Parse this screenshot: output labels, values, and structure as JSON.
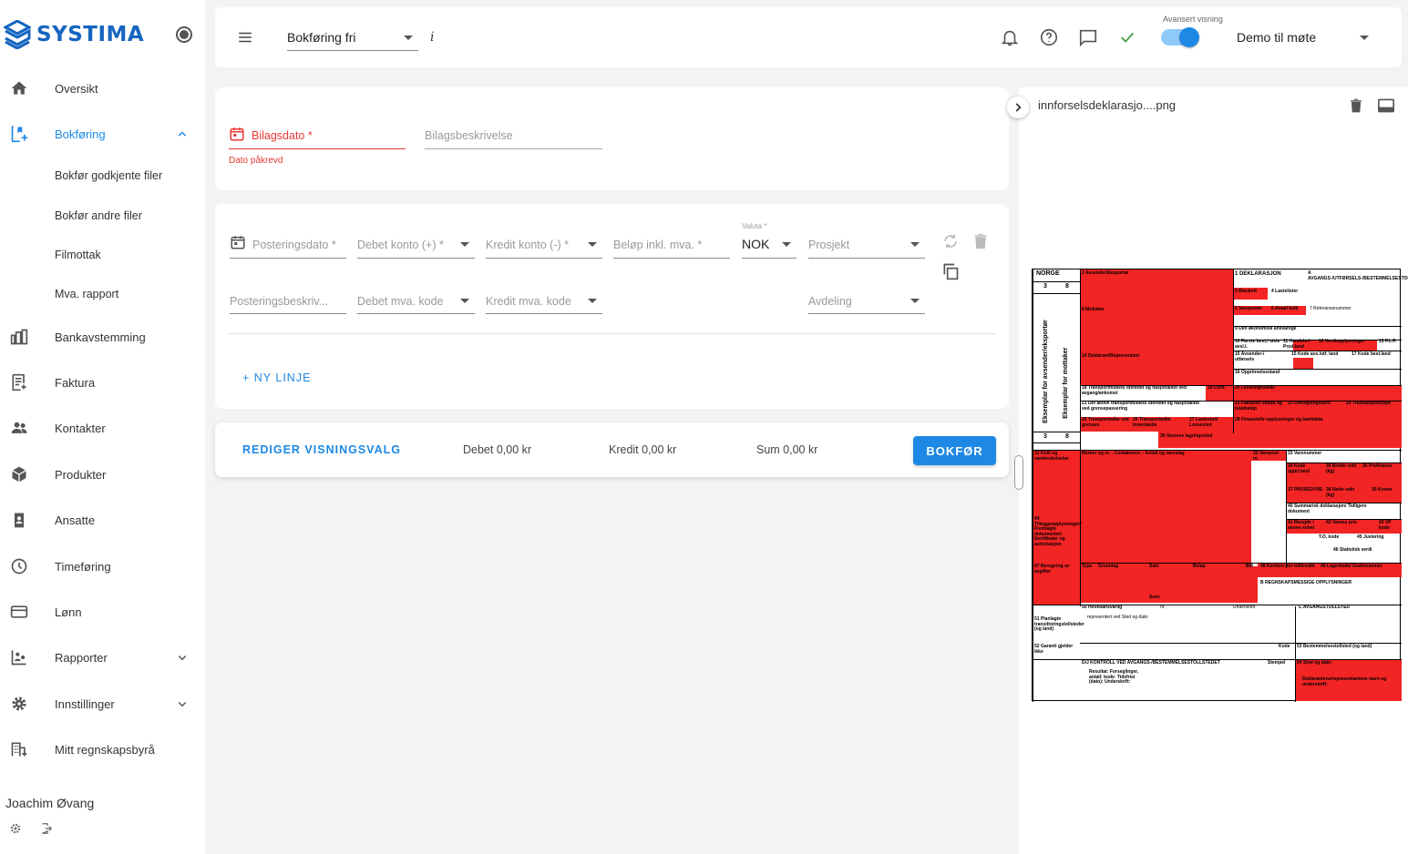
{
  "brand": {
    "name": "SYSTIMA"
  },
  "sidebar": {
    "items": [
      {
        "label": "Oversikt",
        "icon": "home-icon"
      },
      {
        "label": "Bokføring",
        "icon": "book-icon"
      },
      {
        "label": "Bankavstemming",
        "icon": "bank-icon"
      },
      {
        "label": "Faktura",
        "icon": "invoice-icon"
      },
      {
        "label": "Kontakter",
        "icon": "people-icon"
      },
      {
        "label": "Produkter",
        "icon": "box-icon"
      },
      {
        "label": "Ansatte",
        "icon": "badge-icon"
      },
      {
        "label": "Timeføring",
        "icon": "clock-icon"
      },
      {
        "label": "Lønn",
        "icon": "card-icon"
      },
      {
        "label": "Rapporter",
        "icon": "report-icon"
      },
      {
        "label": "Innstillinger",
        "icon": "gear-icon"
      },
      {
        "label": "Mitt regnskapsbyrå",
        "icon": "building-icon"
      }
    ],
    "subitems": [
      "Bokfør godkjente filer",
      "Bokfør andre filer",
      "Filmottak",
      "Mva. rapport"
    ],
    "user": "Joachim Øvang"
  },
  "topbar": {
    "company_select": "Bokføring fri",
    "info": "i",
    "advanced_label": "Avansert visning",
    "advanced_on": true,
    "workspace": "Demo til møte"
  },
  "voucher": {
    "date_label": "Bilagsdato *",
    "date_error": "Dato påkrevd",
    "description_label": "Bilagsbeskrivelse"
  },
  "posting": {
    "date_label": "Posteringsdato *",
    "debit_label": "Debet konto (+) *",
    "credit_label": "Kredit konto (-) *",
    "amount_label": "Beløp inkl. mva. *",
    "currency_label": "Valuta *",
    "currency_value": "NOK",
    "project_label": "Prosjekt",
    "desc_label": "Posteringsbeskriv...",
    "debit_vat_label": "Debet mva. kode",
    "credit_vat_label": "Kredit mva. kode",
    "department_label": "Avdeling",
    "new_line": "+ NY LINJE"
  },
  "footer": {
    "edit_view": "REDIGER VISNINGSVALG",
    "debit": "Debet 0,00 kr",
    "credit": "Kredit 0,00 kr",
    "sum": "Sum 0,00 kr",
    "submit": "BOKFØR"
  },
  "preview": {
    "filename": "innforselsdeklarasjo....png",
    "doc": {
      "country": "NORGE",
      "num_a": "3",
      "num_b": "8",
      "side_left": "Eksemplar for avsender/eksportør",
      "side_right": "Eksemplar for mottaker",
      "f2": "2 Avsender/Eksportør",
      "f1": "1 DEKLARASJON",
      "fa": "A AVGANGS-/UTFØRSELS-/BESTEMMELSESTOLLSTED",
      "f3": "3 Blankett",
      "f4": "4 Lastelister",
      "f5": "5 Vareposter",
      "f6": "6 Antall kolli",
      "f7": "7 Referansenummer",
      "f8": "8 Mottaker",
      "f9": "9 Den økonomisk ansvarlige",
      "f10": "10 Første best./ siste avsl.l.",
      "f11": "11 Handels-/ Prod.land",
      "f12": "12 Verdiopplysninger",
      "f13": "13 F.L.P.",
      "f14": "14 Deklarant/Representant",
      "f15": "15 Avsender-/ utførsels",
      "f15a": "15 Kode avs./utf. land",
      "f17": "17 Kode best.land",
      "f16": "16 Opprinnelsesland",
      "f18": "18 Transportmidlets identitet og nasjonalitet ved avgang/ankomst",
      "f19": "19 Cont.",
      "f20": "20 Leveringsvilkår",
      "f21": "21 Det aktive transportmidlets identitet og nasjonalitet ved grensepassering",
      "f22": "22 Fakturert valuta og totalbeløp",
      "f23": "23 Omregningskurs",
      "f24": "24 Transaksjonstype",
      "f25": "25 Transportmåte ved grensen",
      "f26": "26 Transportmåte innenlands",
      "f27": "27 Lastested/ Lossested",
      "f28": "28 Finansielle opplysninger og bankdata",
      "f30": "30 Varenes lagringssted",
      "f31": "31 Kolli og varebeskrivelse",
      "fmerker": "Merker og nr. - Containernr. - Antall og vareslag",
      "f32": "32 Varepost nr.",
      "f33": "33 Varenummer",
      "f34": "34 Kode opprl.land",
      "f35": "35 Brutto vekt (kg)",
      "f36": "36 Preferanse",
      "f37": "37 PROSEDYRE",
      "f38": "38 Netto vekt (kg)",
      "f39": "39 Kvoter",
      "f40": "40 Summarisk deklarasjon/ Tidligere dokument",
      "f41": "41 Mengde i annen enhet",
      "f42": "42 Varens pris",
      "f43": "43 VP kode",
      "f44": "44 Tilleggsopplysninger/ Fremlagte dokumenter/ Sertifikater og autorisasjon",
      "ftc": "T.O. kode",
      "f45": "45 Justering",
      "f46": "46 Statistisk verdi",
      "f47": "47 Beregning av avgifter",
      "ftype": "Type",
      "fgrunn": "Grunnlag",
      "fsats": "Sats",
      "fbelop": "Beløp",
      "fbm": "BM",
      "f48": "48 Kontonr. for tollkreditt",
      "f49": "49 Lagerkode/ Godsnummer",
      "fb": "B REGNSKAPSMESSIGE OPPLYSNINGER",
      "fsum": "Sum:",
      "f50": "50 Hovedansvarlig",
      "fnr": "nr.",
      "funder": "Underskrift",
      "fc": "C AVGANGSTOLLSTED",
      "frep": "representert ved Sted og dato:",
      "f51": "51 Planlagte transittoringstollsteder (og land)",
      "f52": "52 Garanti gjelder ikke",
      "fkode": "Kode",
      "f53": "53 Bestemmelsestollsted (og land)",
      "fd": "D/J KONTROLL VED AVGANGS-/BESTEMMELSESTOLLSTEDET",
      "fstempel": "Stempel",
      "f54": "54 Sted og dato:",
      "fres": "Resultat: Forseglinger, antall: kode: Tidsfrist (dato): Underskrift:",
      "fdekl": "Deklarantens/representantens navn og underskrift:"
    }
  }
}
